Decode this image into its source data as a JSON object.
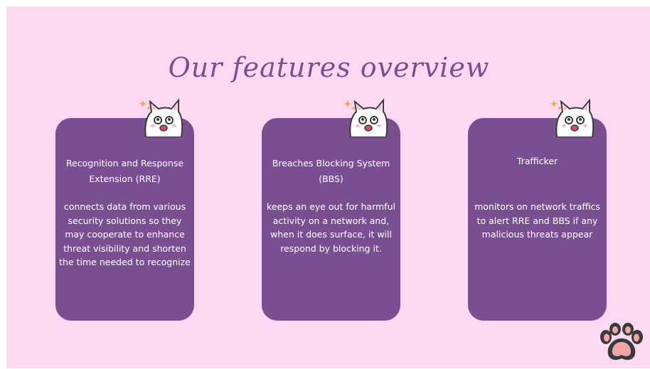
{
  "slide": {
    "title": "Our features overview"
  },
  "features": [
    {
      "heading": "Recognition and Response Extension (RRE)",
      "description": "connects data from various security solutions so they may cooperate to enhance threat visibility and shorten the time needed to recognize"
    },
    {
      "heading": "Breaches Blocking System (BBS)",
      "description": "keeps an eye out for harmful activity on a network and, when it does  surface, it will respond by blocking it."
    },
    {
      "heading": "Trafficker",
      "description": "monitors on network traffics to alert RRE and BBS if any malicious threats appear"
    }
  ],
  "colors": {
    "background": "#fdd9f3",
    "card": "#7a4f91",
    "title": "#7a4f91",
    "paw": "#3a3a3a",
    "paw_pads": "#f2a5a5"
  },
  "icons": [
    "cat-sticker-icon",
    "paw-icon"
  ]
}
